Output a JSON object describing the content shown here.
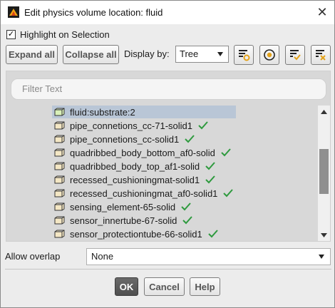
{
  "window": {
    "title": "Edit physics volume location: fluid",
    "close_glyph": "✕"
  },
  "highlight": {
    "checked": true,
    "check_glyph": "✓",
    "label": "Highlight on Selection"
  },
  "toolbar": {
    "expand_label": "Expand all",
    "collapse_label": "Collapse all",
    "display_label": "Display by:",
    "display_value": "Tree",
    "icons": [
      "filter-select-icon",
      "radio-target-icon",
      "checklist-check-icon",
      "checklist-clear-icon"
    ]
  },
  "filter": {
    "placeholder": "Filter Text"
  },
  "list": {
    "items": [
      {
        "label": "fluid:substrate:2",
        "checked": false,
        "selected": true
      },
      {
        "label": "pipe_connetions_cc-71-solid1",
        "checked": true,
        "selected": false
      },
      {
        "label": "pipe_connetions_cc-solid1",
        "checked": true,
        "selected": false
      },
      {
        "label": "quadribbed_body_bottom_af0-solid",
        "checked": true,
        "selected": false
      },
      {
        "label": "quadribbed_body_top_af1-solid",
        "checked": true,
        "selected": false
      },
      {
        "label": "recessed_cushioningmat-solid1",
        "checked": true,
        "selected": false
      },
      {
        "label": "recessed_cushioningmat_af0-solid1",
        "checked": true,
        "selected": false
      },
      {
        "label": "sensing_element-65-solid",
        "checked": true,
        "selected": false
      },
      {
        "label": "sensor_innertube-67-solid",
        "checked": true,
        "selected": false
      },
      {
        "label": "sensor_protectiontube-66-solid1",
        "checked": true,
        "selected": false
      }
    ],
    "check_color": "#2e9a3e",
    "selected_color": "#b9c6d6"
  },
  "overlap": {
    "label": "Allow overlap",
    "value": "None"
  },
  "footer": {
    "ok_label": "OK",
    "cancel_label": "Cancel",
    "help_label": "Help"
  }
}
